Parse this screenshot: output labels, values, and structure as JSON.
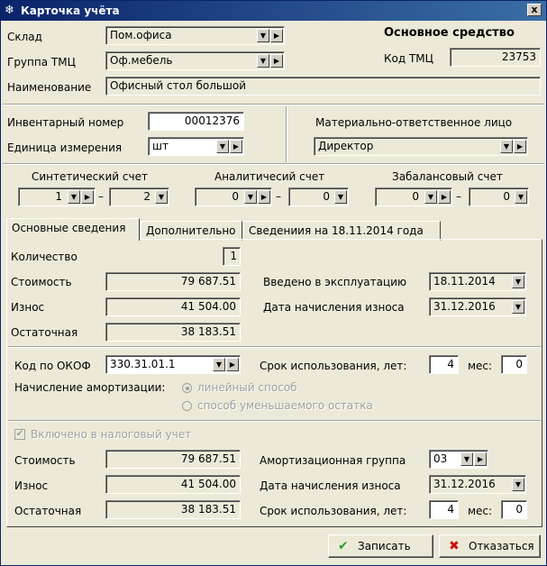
{
  "window": {
    "title": "Карточка учёта",
    "close_glyph": "x"
  },
  "top": {
    "sklad_label": "Склад",
    "sklad_value": "Пом.офиса",
    "gruppa_label": "Группа ТМЦ",
    "gruppa_value": "Оф.мебель",
    "name_label": "Наименование",
    "name_value": "Офисный стол большой",
    "os_heading": "Основное средство",
    "kod_label": "Код ТМЦ",
    "kod_value": "23753"
  },
  "inv": {
    "inv_label": "Инвентарный номер",
    "inv_value": "00012376",
    "unit_label": "Единица измерения",
    "unit_value": "шт",
    "mol_label": "Материально-ответственное лицо",
    "mol_value": "Директор"
  },
  "accounts": {
    "synth_label": "Синтетический счет",
    "synth_from": "1",
    "synth_to": "2",
    "anal_label": "Аналитичесий счет",
    "anal_from": "0",
    "anal_to": "0",
    "off_label": "Забалансовый счет",
    "off_from": "0",
    "off_to": "0",
    "dash": "–"
  },
  "tabs": [
    "Основные сведения",
    "Дополнительно",
    "Сведениия на 18.11.2014 года"
  ],
  "main": {
    "qty_label": "Количество",
    "qty_value": "1",
    "cost_label": "Стоимость",
    "cost_value": "79 687.51",
    "wear_label": "Износ",
    "wear_value": "41 504.00",
    "rest_label": "Остаточная",
    "rest_value": "38 183.51",
    "intro_label": "Введено в эксплуатацию",
    "intro_value": "18.11.2014",
    "depr_date_label": "Дата начисления износа",
    "depr_date_value": "31.12.2016"
  },
  "okof": {
    "okof_label": "Код по ОКОФ",
    "okof_value": "330.31.01.1",
    "life_label": "Срок использования, лет:",
    "life_years": "4",
    "months_label": "мес:",
    "life_months": "0",
    "amort_label": "Начисление амортизации:",
    "opt_linear": "линейный способ",
    "opt_reducing": "способ уменьшаемого остатка"
  },
  "tax": {
    "included_label": "Включено в налоговый учет",
    "check_glyph": "✔",
    "cost_label": "Стоимость",
    "cost_value": "79 687.51",
    "wear_label": "Износ",
    "wear_value": "41 504.00",
    "rest_label": "Остаточная",
    "rest_value": "38 183.51",
    "group_label": "Амортизационная группа",
    "group_value": "03",
    "depr_date_label": "Дата начисления износа",
    "depr_date_value": "31.12.2016",
    "life_label": "Срок использования, лет:",
    "life_years": "4",
    "months_label": "мес:",
    "life_months": "0"
  },
  "buttons": {
    "save": "Записать",
    "cancel": "Отказаться",
    "save_glyph": "✔",
    "cancel_glyph": "✖"
  },
  "glyphs": {
    "dropdown": "▼",
    "more": "▶"
  },
  "colors": {
    "title_bar": "#0a246a",
    "save_icon": "#2e9e2e",
    "cancel_icon": "#cc1010"
  }
}
